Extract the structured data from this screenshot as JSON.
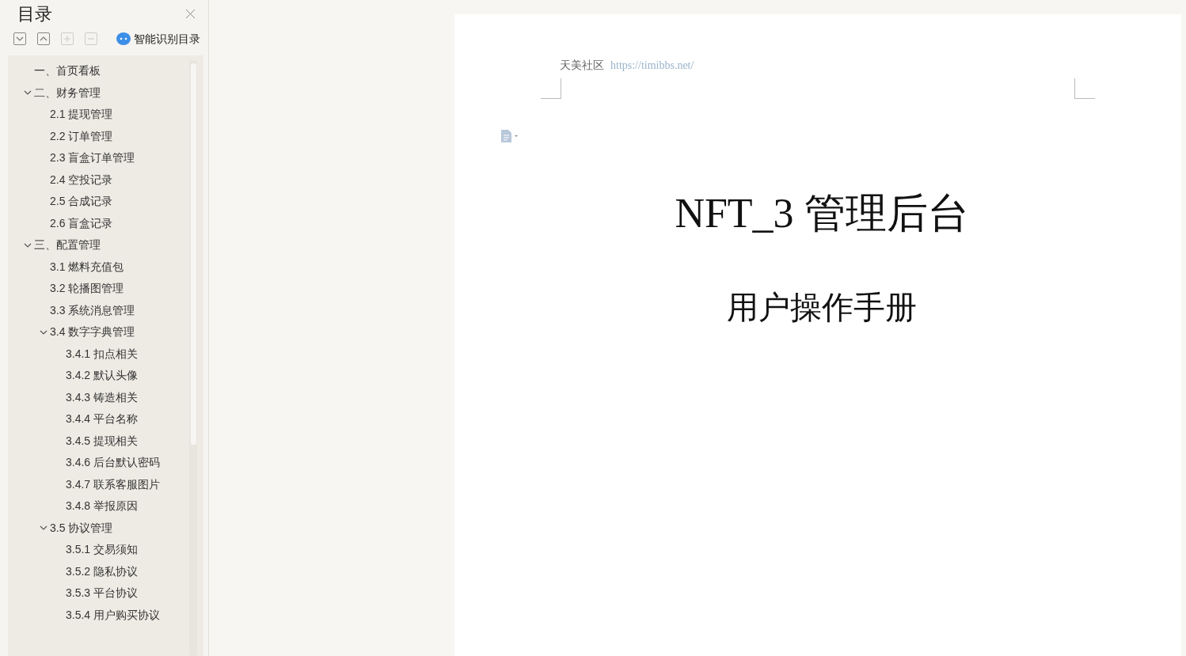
{
  "sidebar": {
    "title": "目录",
    "smart_toc": "智能识别目录",
    "tree": [
      {
        "label": "一、首页看板"
      },
      {
        "label": "二、财务管理",
        "expanded": true,
        "children": [
          {
            "label": "2.1 提现管理"
          },
          {
            "label": "2.2 订单管理"
          },
          {
            "label": "2.3 盲盒订单管理"
          },
          {
            "label": "2.4 空投记录"
          },
          {
            "label": "2.5 合成记录"
          },
          {
            "label": "2.6 盲盒记录"
          }
        ]
      },
      {
        "label": "三、配置管理",
        "expanded": true,
        "children": [
          {
            "label": "3.1 燃料充值包"
          },
          {
            "label": "3.2 轮播图管理"
          },
          {
            "label": "3.3 系统消息管理"
          },
          {
            "label": "3.4 数字字典管理",
            "expanded": true,
            "children": [
              {
                "label": "3.4.1 扣点相关"
              },
              {
                "label": "3.4.2 默认头像"
              },
              {
                "label": "3.4.3 铸造相关"
              },
              {
                "label": "3.4.4 平台名称"
              },
              {
                "label": "3.4.5 提现相关"
              },
              {
                "label": "3.4.6 后台默认密码"
              },
              {
                "label": "3.4.7 联系客服图片"
              },
              {
                "label": "3.4.8 举报原因"
              }
            ]
          },
          {
            "label": "3.5 协议管理",
            "expanded": true,
            "children": [
              {
                "label": "3.5.1 交易须知"
              },
              {
                "label": "3.5.2 隐私协议"
              },
              {
                "label": "3.5.3 平台协议"
              },
              {
                "label": "3.5.4 用户购买协议"
              }
            ]
          }
        ]
      }
    ]
  },
  "document": {
    "header_text": "天美社区",
    "header_url": "https://timibbs.net/",
    "title": "NFT_3 管理后台",
    "subtitle": "用户操作手册"
  }
}
